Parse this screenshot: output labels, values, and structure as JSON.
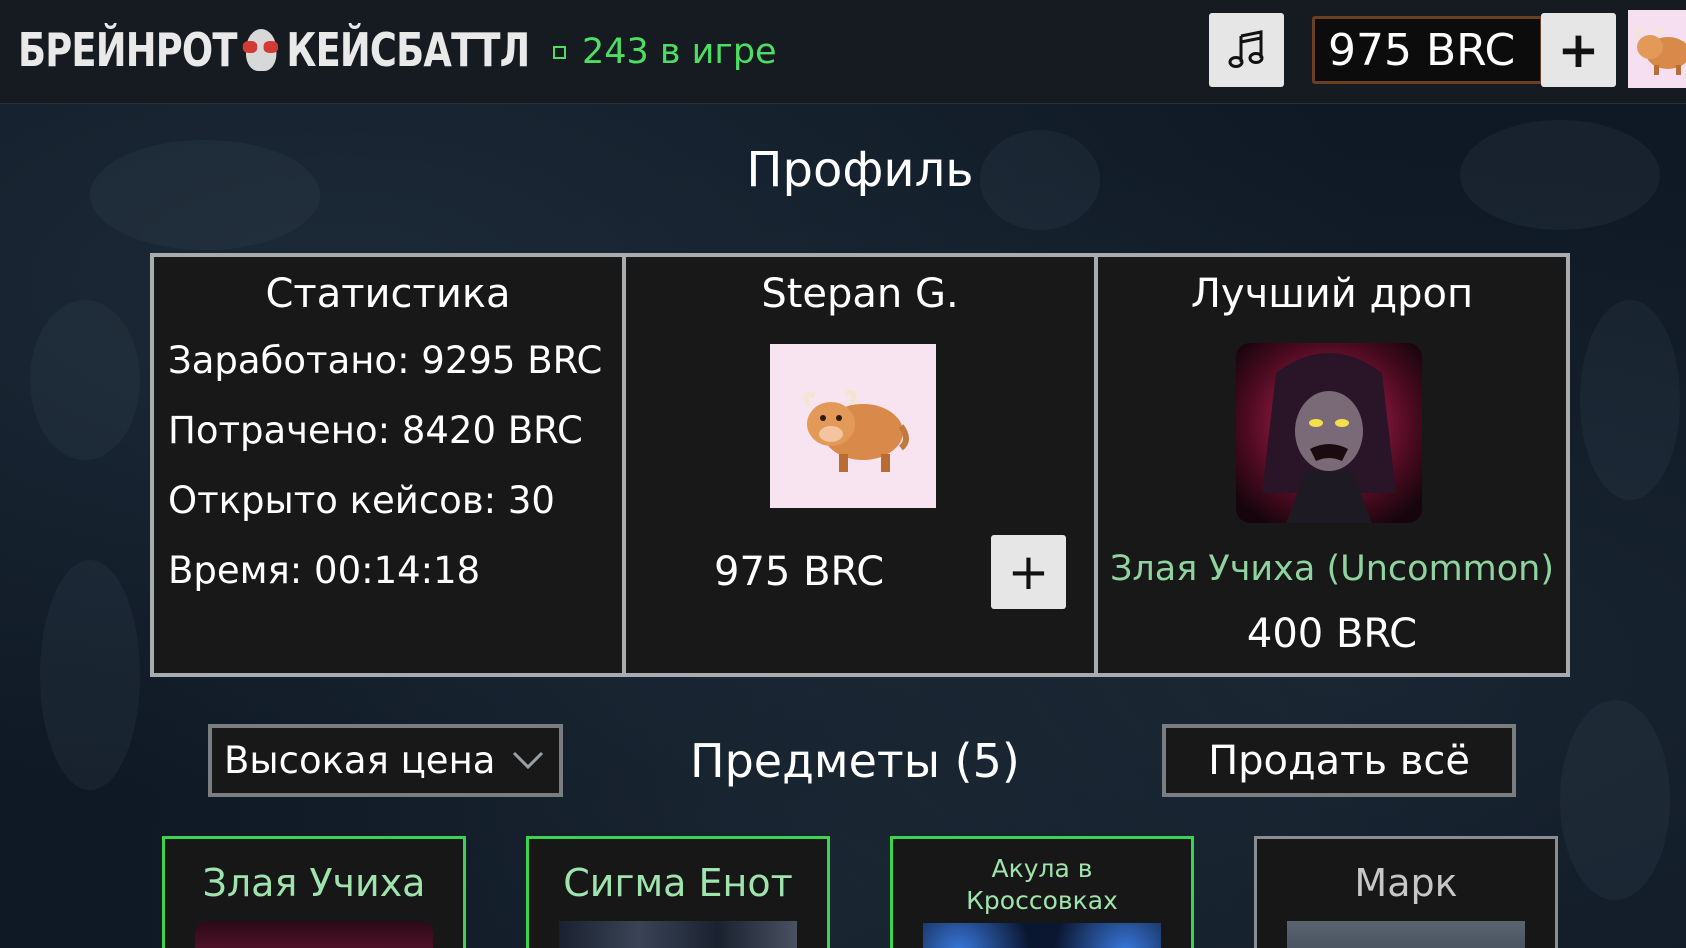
{
  "header": {
    "logo_left": "БРЕЙНРОТ",
    "logo_right": "КЕЙСБАТТЛ",
    "online": "243 в игре",
    "balance": "975 BRC",
    "plus_label": "+",
    "music_icon": "music-note-icon",
    "avatar_icon": "yak-avatar-icon"
  },
  "page": {
    "title": "Профиль"
  },
  "stats": {
    "title": "Статистика",
    "earned": "Заработано: 9295 BRC",
    "spent": "Потрачено: 8420 BRC",
    "cases_opened": "Открыто кейсов: 30",
    "time": "Время: 00:14:18"
  },
  "profile": {
    "name": "Stepan G.",
    "balance": "975 BRC",
    "plus_label": "+"
  },
  "best_drop": {
    "title": "Лучший дроп",
    "item_name": "Злая Учиха (Uncommon)",
    "price": "400 BRC",
    "name_color": "#8fd39e"
  },
  "controls": {
    "sort_value": "Высокая цена",
    "items_title": "Предметы (5)",
    "sell_all": "Продать всё"
  },
  "items": [
    {
      "name": "Злая Учиха",
      "rarity": "uncommon"
    },
    {
      "name": "Сигма Енот",
      "rarity": "uncommon"
    },
    {
      "name": "Акула в Кроссовках",
      "rarity": "uncommon"
    },
    {
      "name": "Марк",
      "rarity": "common"
    }
  ],
  "colors": {
    "online_green": "#4cde62",
    "uncommon_border": "#3cd34f",
    "common_border": "#8a8d91",
    "balance_border": "#6b3f22"
  }
}
